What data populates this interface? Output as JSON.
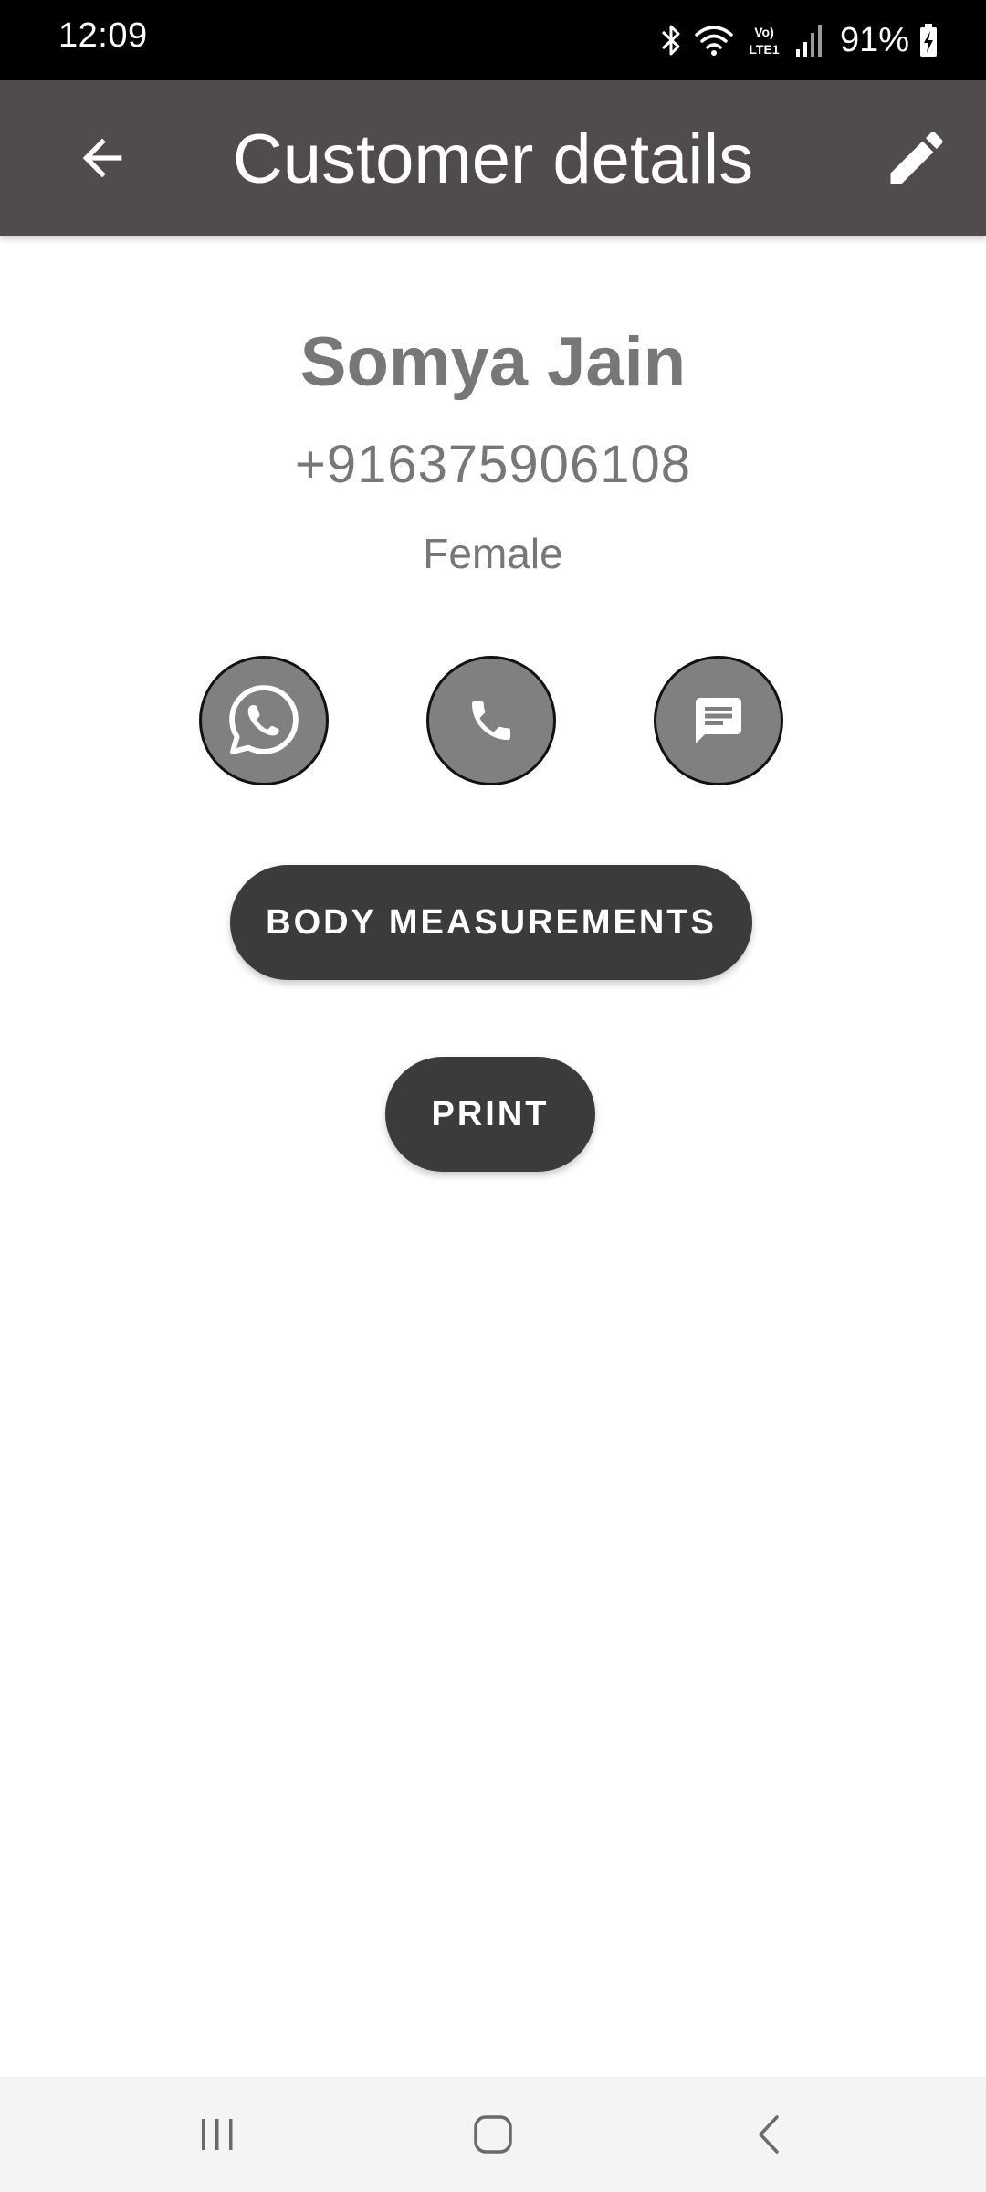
{
  "status_bar": {
    "time": "12:09",
    "network_label": "Vo) LTE1",
    "battery": "91%"
  },
  "app_bar": {
    "title": "Customer details",
    "back_icon": "arrow-left-icon",
    "edit_icon": "pencil-icon"
  },
  "customer": {
    "name": "Somya Jain",
    "phone": "+916375906108",
    "gender": "Female"
  },
  "contact_actions": [
    {
      "icon": "whatsapp-icon"
    },
    {
      "icon": "phone-icon"
    },
    {
      "icon": "message-icon"
    }
  ],
  "buttons": {
    "measurements_label": "BODY MEASUREMENTS",
    "print_label": "PRINT"
  },
  "nav_bar": {
    "recents_icon": "recents-icon",
    "home_icon": "home-icon",
    "back_icon": "back-chevron-icon"
  },
  "colors": {
    "app_bar": "#4f4c4b",
    "action_circle": "#808080",
    "pill_button": "#3c3b3b",
    "text_secondary": "#777777"
  }
}
